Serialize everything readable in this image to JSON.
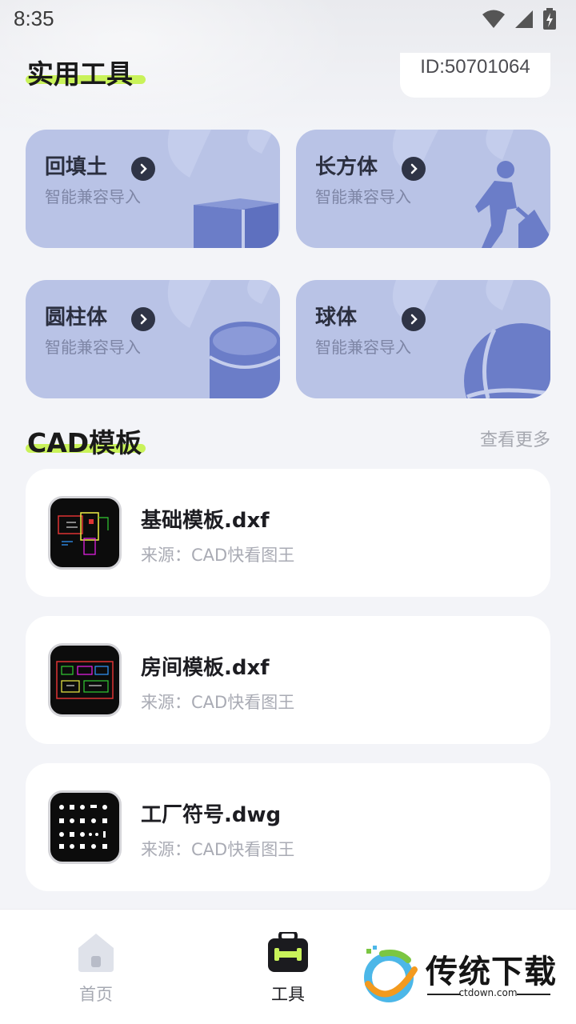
{
  "status_bar": {
    "time": "8:35"
  },
  "header": {
    "title": "实用工具",
    "user_id": "ID:50701064"
  },
  "tools": [
    {
      "name": "回填土",
      "subtitle": "智能兼容导入",
      "icon": "cube-icon"
    },
    {
      "name": "长方体",
      "subtitle": "智能兼容导入",
      "icon": "worker-shovel-icon"
    },
    {
      "name": "圆柱体",
      "subtitle": "智能兼容导入",
      "icon": "cylinder-icon"
    },
    {
      "name": "球体",
      "subtitle": "智能兼容导入",
      "icon": "sphere-icon"
    }
  ],
  "templates_section": {
    "title": "CAD模板",
    "more_label": "查看更多"
  },
  "templates": [
    {
      "name": "基础模板.dxf",
      "source": "来源：CAD快看图王"
    },
    {
      "name": "房间模板.dxf",
      "source": "来源：CAD快看图王"
    },
    {
      "name": "工厂符号.dwg",
      "source": "来源：CAD快看图王"
    }
  ],
  "bottom_nav": {
    "items": [
      {
        "label": "首页",
        "icon": "home-icon",
        "active": false
      },
      {
        "label": "工具",
        "icon": "toolbox-icon",
        "active": true
      }
    ]
  },
  "watermark": {
    "text": "传统下载",
    "url": "ctdown.com"
  },
  "colors": {
    "accent_highlight": "#c9f25a",
    "tool_card_bg": "#b9c3e6",
    "tool_illustration": "#6b7dc8",
    "page_bg": "#f3f4f8"
  }
}
